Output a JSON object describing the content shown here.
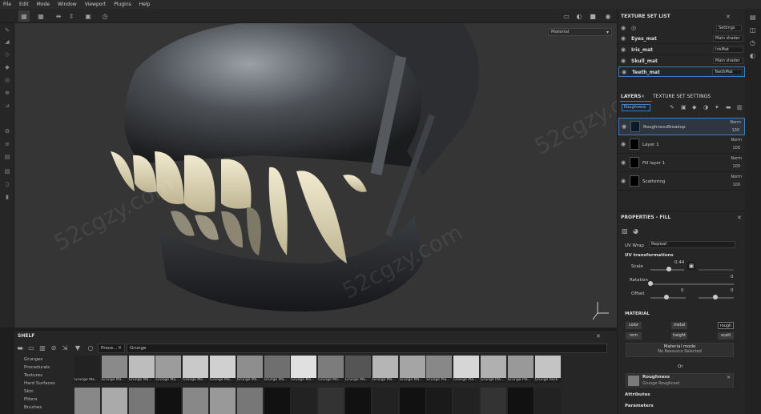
{
  "menu": [
    "File",
    "Edit",
    "Mode",
    "Window",
    "Viewport",
    "Plugins",
    "Help"
  ],
  "viewport": {
    "mode_label": "Material"
  },
  "texture_set_list": {
    "title": "TEXTURE SET LIST",
    "settings_label": "Settings",
    "items": [
      {
        "name": "Eyes_mat",
        "shader": "Main shader"
      },
      {
        "name": "Iris_mat",
        "shader": "IrisMat"
      },
      {
        "name": "Skull_mat",
        "shader": "Main shader"
      },
      {
        "name": "Teeth_mat",
        "shader": "TeethMat"
      }
    ]
  },
  "layers": {
    "tab_layers": "LAYERS",
    "tab_settings": "TEXTURE SET SETTINGS",
    "channel": "Roughness",
    "items": [
      {
        "name": "RoughnessBreakup",
        "blend": "Norm",
        "opacity": "100"
      },
      {
        "name": "Layer 1",
        "blend": "Norm",
        "opacity": "100"
      },
      {
        "name": "Fill layer 1",
        "blend": "Norm",
        "opacity": "100"
      },
      {
        "name": "Scattering",
        "blend": "Norm",
        "opacity": "100"
      }
    ]
  },
  "properties": {
    "title": "PROPERTIES - FILL",
    "uv_wrap_label": "UV Wrap",
    "uv_wrap_value": "Repeat",
    "uv_section": "UV transformations",
    "scale_label": "Scale",
    "scale_value": "0.44",
    "rotation_label": "Rotation",
    "rotation_value": "0",
    "offset_label": "Offset",
    "offset_x": "0",
    "offset_y": "0",
    "material_section": "MATERIAL",
    "mat_buttons": [
      "color",
      "metal",
      "rough",
      "nrm",
      "height",
      "scatt"
    ],
    "material_mode_label": "Material mode",
    "material_mode_value": "No Resource Selected",
    "or_label": "Or",
    "roughness_label": "Roughness",
    "roughness_value": "Grunge Roughcast",
    "attributes_section": "Attributes",
    "parameters_section": "Parameters"
  },
  "shelf": {
    "title": "SHELF",
    "filter_chip": "Proce...",
    "search_value": "Grunge",
    "categories": [
      "Grunges",
      "Procedurals",
      "Textures",
      "Hard Surfaces",
      "Skin",
      "Filters",
      "Brushes"
    ],
    "row1_labels": [
      "Grunge Ma...",
      "Grunge Ma...",
      "Grunge Ma...",
      "Grunge Ma...",
      "Grunge Ma...",
      "Grunge Ma...",
      "Grunge Ma...",
      "Grunge Ma...",
      "Grunge Ma...",
      "Grunge Ma...",
      "Grunge Ma...",
      "Grunge Ma...",
      "Grunge Ma...",
      "Grunge Pla...",
      "Grunge Pla...",
      "Grunge Pla...",
      "Grunge Pla...",
      "Grunge Rock"
    ]
  },
  "colors": {
    "accent": "#3d7fc4",
    "bg": "#262626",
    "viewport": "#353535"
  }
}
